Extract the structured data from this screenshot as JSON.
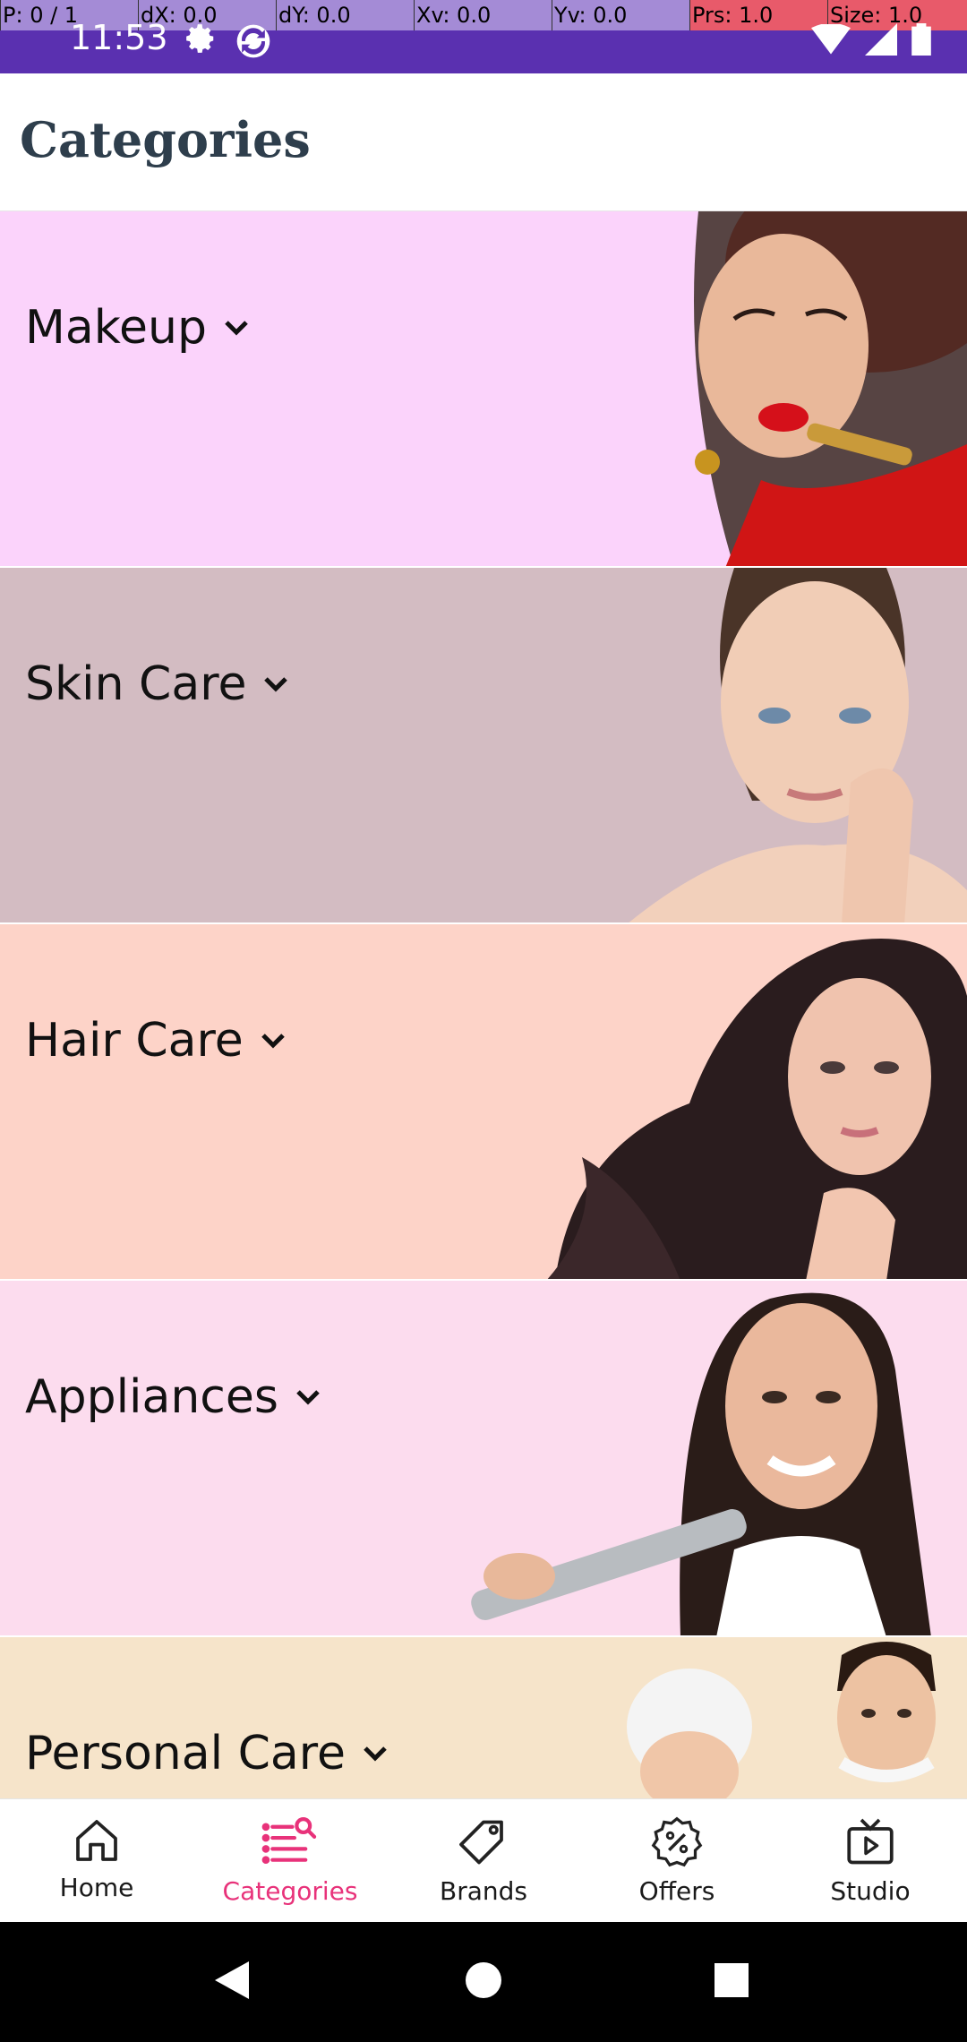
{
  "debug": {
    "cells": [
      "P: 0 / 1",
      "dX: 0.0",
      "dY: 0.0",
      "Xv: 0.0",
      "Yv: 0.0",
      "Prs: 1.0",
      "Size: 1.0"
    ]
  },
  "status_bar": {
    "time": "11:53",
    "icons_left": [
      "gear-icon",
      "sync-icon"
    ],
    "icons_right": [
      "wifi-icon",
      "signal-icon",
      "battery-icon"
    ]
  },
  "header": {
    "title": "Categories"
  },
  "categories": [
    {
      "label": "Makeup",
      "bg": "#fbd3fb",
      "icon": "chevron-down-icon"
    },
    {
      "label": "Skin Care",
      "bg": "#d3bcc2",
      "icon": "chevron-down-icon"
    },
    {
      "label": "Hair Care",
      "bg": "#fdd3c8",
      "icon": "chevron-down-icon"
    },
    {
      "label": "Appliances",
      "bg": "#fcdcee",
      "icon": "chevron-down-icon"
    },
    {
      "label": "Personal Care",
      "bg": "#f6e4ca",
      "icon": "chevron-down-icon"
    }
  ],
  "bottom_nav": {
    "items": [
      {
        "label": "Home",
        "icon": "home-icon",
        "active": false
      },
      {
        "label": "Categories",
        "icon": "categories-icon",
        "active": true
      },
      {
        "label": "Brands",
        "icon": "tag-icon",
        "active": false
      },
      {
        "label": "Offers",
        "icon": "percent-badge-icon",
        "active": false
      },
      {
        "label": "Studio",
        "icon": "tv-play-icon",
        "active": false
      }
    ],
    "active_color": "#e8327a"
  },
  "system_nav": {
    "buttons": [
      "back-icon",
      "home-circle-icon",
      "recents-icon"
    ]
  },
  "colors": {
    "status_bar": "#5a30b0",
    "debug_bar": "#a48bd6",
    "title_text": "#2e3e4c"
  }
}
